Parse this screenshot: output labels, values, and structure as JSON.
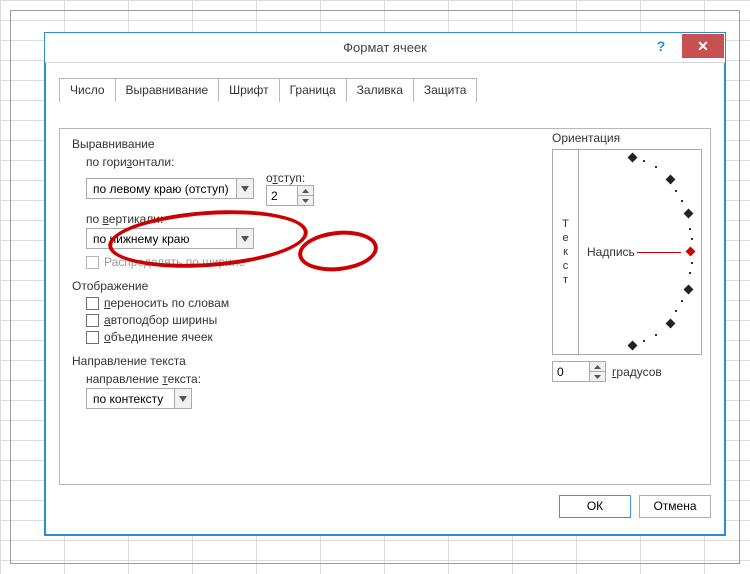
{
  "window": {
    "title": "Формат ячеек",
    "help_btn": "?",
    "close_btn": "✕"
  },
  "tabs": [
    "Число",
    "Выравнивание",
    "Шрифт",
    "Граница",
    "Заливка",
    "Защита"
  ],
  "active_tab_index": 1,
  "alignment": {
    "group": "Выравнивание",
    "horizontal_label": "по горизонтали:",
    "horizontal_value": "по левому краю (отступ)",
    "indent_label": "отступ:",
    "indent_value": "2",
    "vertical_label": "по вертикали:",
    "vertical_value": "по нижнему краю",
    "distribute_label": "Распределять по ширине"
  },
  "display": {
    "group": "Отображение",
    "wrap": "переносить по словам",
    "autofit": "автоподбор ширины",
    "merge": "объединение ячеек"
  },
  "textdir": {
    "group": "Направление текста",
    "label": "направление текста:",
    "value": "по контексту"
  },
  "orientation": {
    "group": "Ориентация",
    "vtext": [
      "Т",
      "е",
      "к",
      "с",
      "т"
    ],
    "nadpis": "Надпись",
    "deg_value": "0",
    "deg_label": "градусов"
  },
  "footer": {
    "ok": "ОК",
    "cancel": "Отмена"
  }
}
